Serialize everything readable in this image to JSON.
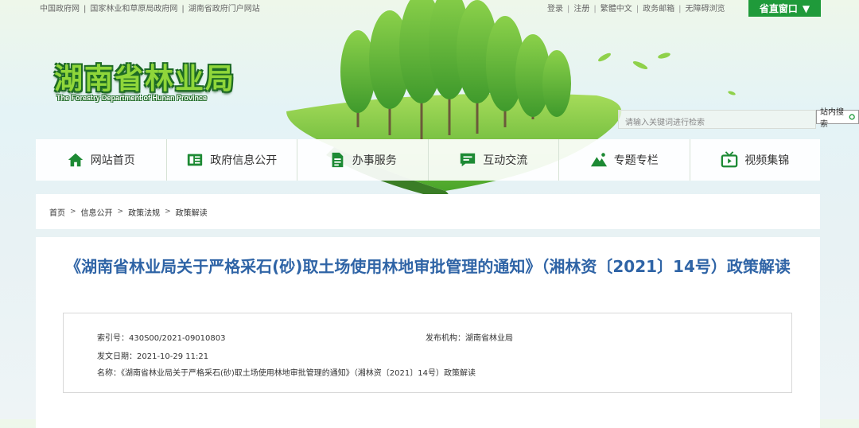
{
  "topbar": {
    "left_links": [
      "中国政府网",
      "国家林业和草原局政府网",
      "湖南省政府门户网站"
    ],
    "right_links": [
      "登录",
      "注册",
      "繁體中文",
      "政务邮箱",
      "无障碍浏览"
    ],
    "province_btn": "省直窗口",
    "province_arrow": "▼"
  },
  "header": {
    "logo_cn": "湖南省林业局",
    "logo_en": "The Forestry Department of Hunan Province"
  },
  "search": {
    "placeholder": "请输入关键词进行检索",
    "button": "站内搜索"
  },
  "nav": {
    "items": [
      {
        "label": "网站首页",
        "icon": "home-icon"
      },
      {
        "label": "政府信息公开",
        "icon": "info-card-icon"
      },
      {
        "label": "办事服务",
        "icon": "document-icon"
      },
      {
        "label": "互动交流",
        "icon": "chat-icon"
      },
      {
        "label": "专题专栏",
        "icon": "mountain-icon"
      },
      {
        "label": "视频集锦",
        "icon": "tv-icon"
      }
    ]
  },
  "breadcrumb": [
    "首页",
    "信息公开",
    "政策法规",
    "政策解读"
  ],
  "article": {
    "title": "《湖南省林业局关于严格采石(砂)取土场使用林地审批管理的通知》（湘林资〔2021〕14号）政策解读",
    "index_label": "索引号：",
    "index_value": "430S00/2021-09010803",
    "publisher_label": "发布机构：",
    "publisher_value": "湖南省林业局",
    "date_label": "发文日期：",
    "date_value": "2021-10-29 11:21",
    "name_label": "名称：",
    "name_value": "《湖南省林业局关于严格采石(砂)取土场使用林地审批管理的通知》（湘林资〔2021〕14号）政策解读"
  },
  "colors": {
    "accent_green": "#1f9a3a",
    "title_blue": "#2f64a6",
    "nav_icon_green": "#1d8a34"
  }
}
